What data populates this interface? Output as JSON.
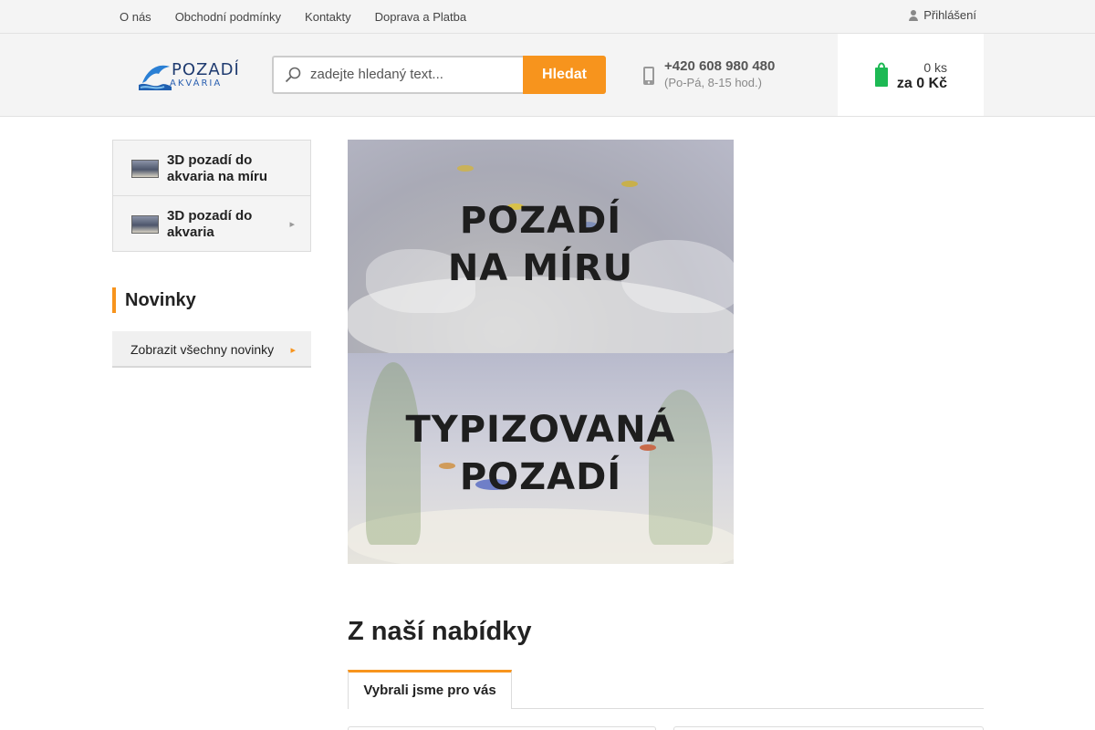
{
  "topnav": {
    "links": [
      "O nás",
      "Obchodní podmínky",
      "Kontakty",
      "Doprava a Platba"
    ],
    "login_label": "Přihlášení"
  },
  "header": {
    "logo_line1": "POZADÍ",
    "logo_line2": "AKVÁRIA",
    "search": {
      "placeholder": "zadejte hledaný text...",
      "button_label": "Hledat"
    },
    "phone": {
      "number": "+420 608 980 480",
      "hours": "(Po-Pá, 8-15 hod.)"
    },
    "cart": {
      "count": "0 ks",
      "price": "za 0 Kč"
    }
  },
  "sidebar": {
    "categories": [
      {
        "label": "3D pozadí do akvaria na míru",
        "has_arrow": false
      },
      {
        "label": "3D pozadí do akvaria",
        "has_arrow": true
      }
    ],
    "news_heading": "Novinky",
    "news_button": "Zobrazit všechny novinky"
  },
  "banner": {
    "top": {
      "line1": "POZADÍ",
      "line2": "NA MÍRU"
    },
    "bottom": {
      "line1": "TYPIZOVANÁ",
      "line2": "POZADÍ"
    }
  },
  "offer": {
    "title": "Z naší nabídky",
    "tabs": [
      "Vybrali jsme pro vás"
    ]
  },
  "colors": {
    "accent": "#f7941d",
    "cart_icon": "#1db954",
    "brand_blue": "#1f3b70"
  }
}
